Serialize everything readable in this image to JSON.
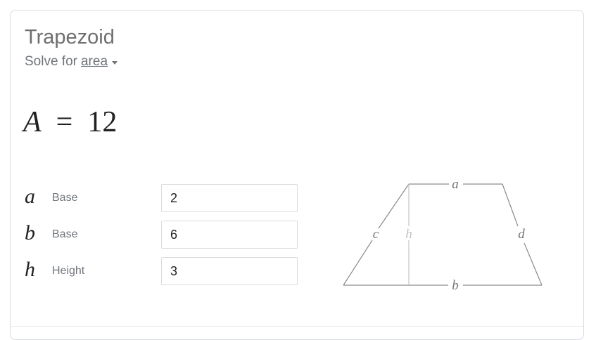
{
  "calculator": {
    "title": "Trapezoid",
    "solve_prefix": "Solve for",
    "solve_target": "area"
  },
  "result": {
    "variable": "A",
    "equals": "=",
    "value": "12"
  },
  "inputs": [
    {
      "symbol": "a",
      "label": "Base",
      "value": "2"
    },
    {
      "symbol": "b",
      "label": "Base",
      "value": "6"
    },
    {
      "symbol": "h",
      "label": "Height",
      "value": "3"
    }
  ],
  "diagram": {
    "label_a": "a",
    "label_b": "b",
    "label_c": "c",
    "label_d": "d",
    "label_h": "h",
    "line_color": "#8a8a8a",
    "height_color": "#c4c4c4"
  }
}
